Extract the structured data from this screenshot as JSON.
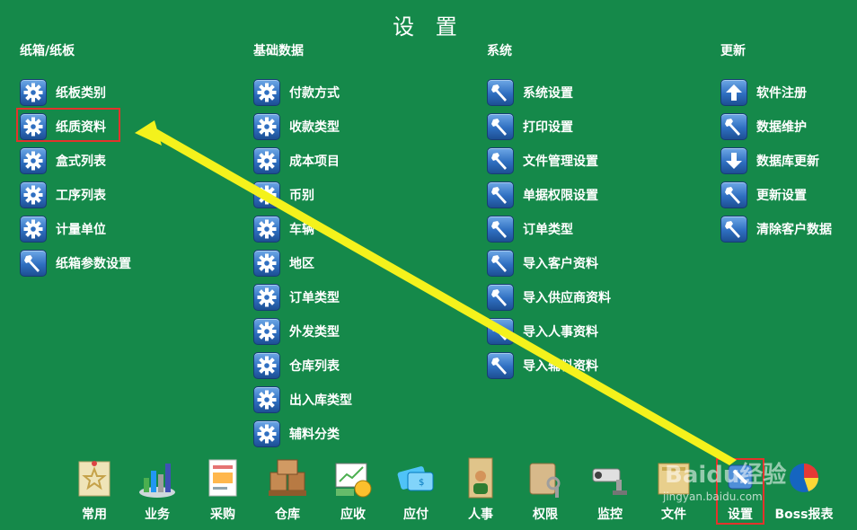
{
  "title": "设 置",
  "columns": [
    {
      "heading": "纸箱/纸板",
      "items": [
        {
          "label": "纸板类别",
          "icon": "gear"
        },
        {
          "label": "纸质资料",
          "icon": "gear",
          "highlight": true
        },
        {
          "label": "盒式列表",
          "icon": "gear"
        },
        {
          "label": "工序列表",
          "icon": "gear"
        },
        {
          "label": "计量单位",
          "icon": "gear"
        },
        {
          "label": "纸箱参数设置",
          "icon": "wrench"
        }
      ]
    },
    {
      "heading": "基础数据",
      "items": [
        {
          "label": "付款方式",
          "icon": "gear"
        },
        {
          "label": "收款类型",
          "icon": "gear"
        },
        {
          "label": "成本项目",
          "icon": "gear"
        },
        {
          "label": "币别",
          "icon": "gear"
        },
        {
          "label": "车辆",
          "icon": "gear"
        },
        {
          "label": "地区",
          "icon": "gear"
        },
        {
          "label": "订单类型",
          "icon": "gear"
        },
        {
          "label": "外发类型",
          "icon": "gear"
        },
        {
          "label": "仓库列表",
          "icon": "gear"
        },
        {
          "label": "出入库类型",
          "icon": "gear"
        },
        {
          "label": "辅料分类",
          "icon": "gear"
        }
      ]
    },
    {
      "heading": "系统",
      "items": [
        {
          "label": "系统设置",
          "icon": "wrench"
        },
        {
          "label": "打印设置",
          "icon": "wrench"
        },
        {
          "label": "文件管理设置",
          "icon": "wrench"
        },
        {
          "label": "单据权限设置",
          "icon": "wrench"
        },
        {
          "label": "订单类型",
          "icon": "wrench"
        },
        {
          "label": "导入客户资料",
          "icon": "wrench"
        },
        {
          "label": "导入供应商资料",
          "icon": "wrench"
        },
        {
          "label": "导入人事资料",
          "icon": "wrench"
        },
        {
          "label": "导入辅料资料",
          "icon": "wrench"
        }
      ]
    },
    {
      "heading": "更新",
      "items": [
        {
          "label": "软件注册",
          "icon": "arrow-up"
        },
        {
          "label": "数据维护",
          "icon": "wrench"
        },
        {
          "label": "数据库更新",
          "icon": "arrow-down"
        },
        {
          "label": "更新设置",
          "icon": "wrench"
        },
        {
          "label": "清除客户数据",
          "icon": "wrench"
        }
      ]
    }
  ],
  "taskbar": [
    {
      "label": "常用",
      "icon": "star-note"
    },
    {
      "label": "业务",
      "icon": "bar-chart"
    },
    {
      "label": "采购",
      "icon": "receipt"
    },
    {
      "label": "仓库",
      "icon": "boxes"
    },
    {
      "label": "应收",
      "icon": "cash"
    },
    {
      "label": "应付",
      "icon": "payment-card"
    },
    {
      "label": "人事",
      "icon": "person-folder"
    },
    {
      "label": "权限",
      "icon": "keys"
    },
    {
      "label": "监控",
      "icon": "camera"
    },
    {
      "label": "文件",
      "icon": "folder"
    },
    {
      "label": "设置",
      "icon": "tools",
      "active": true
    },
    {
      "label": "Boss报表",
      "icon": "pie-chart"
    }
  ],
  "watermark": {
    "brand": "Baidu经验",
    "url": "jingyan.baidu.com"
  },
  "colors": {
    "background": "#15894a",
    "highlight": "#e3332c",
    "arrow": "#f4f21c"
  }
}
